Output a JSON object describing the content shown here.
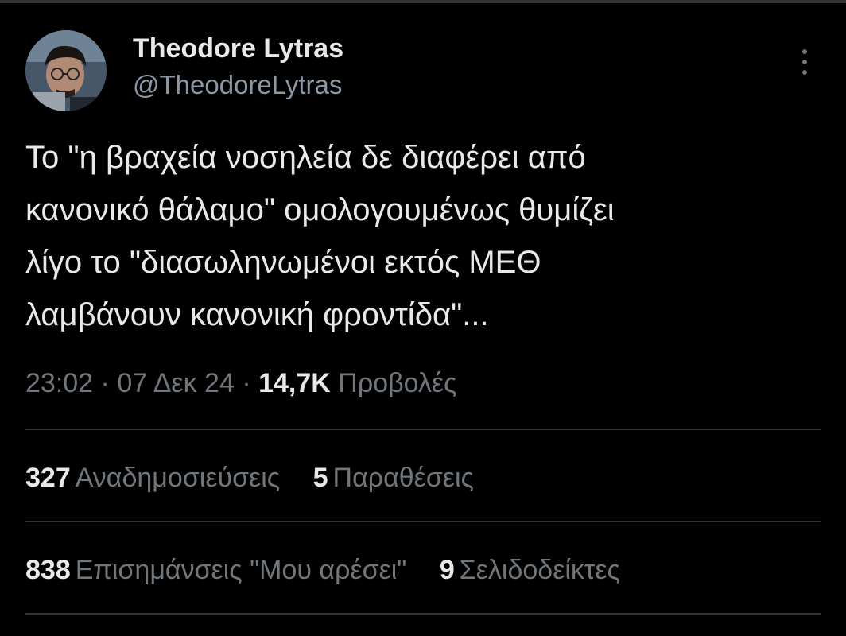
{
  "author": {
    "display_name": "Theodore Lytras",
    "handle": "@TheodoreLytras"
  },
  "more_icon": "more-vertical-icon",
  "tweet": {
    "text": "Το \"η βραχεία νοσηλεία δε διαφέρει από\nκανονικό θάλαμο\" ομολογουμένως θυμίζει\nλίγο το \"διασωληνωμένοι εκτός ΜΕΘ\nλαμβάνουν κανονική φροντίδα\"...",
    "time": "23:02",
    "date": "07 Δεκ 24",
    "separator": "·",
    "views_count": "14,7K",
    "views_label": "Προβολές"
  },
  "stats_row_1": [
    {
      "count": "327",
      "label": "Αναδημοσιεύσεις"
    },
    {
      "count": "5",
      "label": "Παραθέσεις"
    }
  ],
  "stats_row_2": [
    {
      "count": "838",
      "label": "Επισημάνσεις \"Μου αρέσει\""
    },
    {
      "count": "9",
      "label": "Σελιδοδείκτες"
    }
  ],
  "colors": {
    "background": "#000000",
    "text_primary": "#e7e9ea",
    "text_secondary": "#71767b",
    "divider": "#2f3336"
  }
}
